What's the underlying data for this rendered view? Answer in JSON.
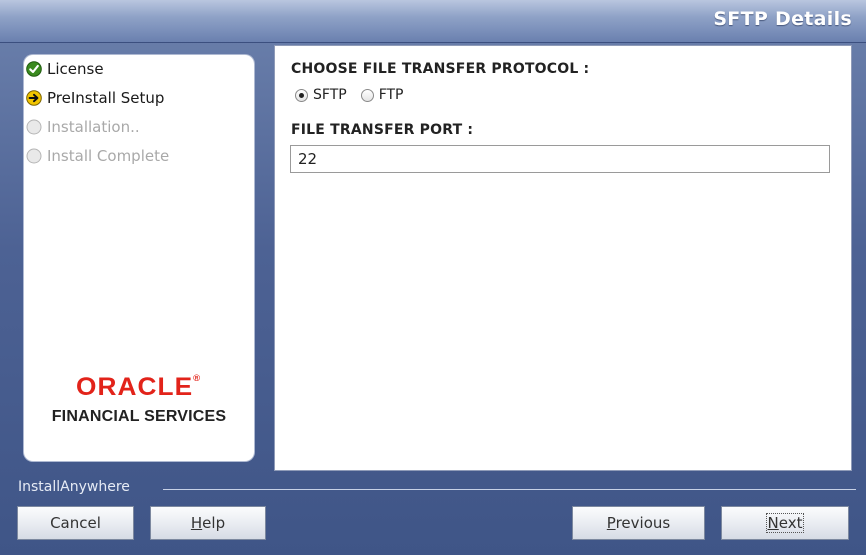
{
  "header": {
    "title": "SFTP Details"
  },
  "steps": [
    {
      "label": "License",
      "status": "complete",
      "icon": "check-icon"
    },
    {
      "label": "PreInstall Setup",
      "status": "current",
      "icon": "arrow-right-icon"
    },
    {
      "label": "Installation..",
      "status": "pending",
      "icon": "empty-circle-icon"
    },
    {
      "label": "Install Complete",
      "status": "pending",
      "icon": "empty-circle-icon"
    }
  ],
  "logo": {
    "brand": "ORACLE",
    "trademark": "®",
    "subtitle": "FINANCIAL SERVICES"
  },
  "form": {
    "protocol_label": "CHOOSE FILE TRANSFER PROTOCOL :",
    "protocol_options": [
      {
        "label": "SFTP",
        "selected": true
      },
      {
        "label": "FTP",
        "selected": false
      }
    ],
    "port_label": "FILE TRANSFER PORT :",
    "port_value": "22"
  },
  "footer": {
    "vendor": "InstallAnywhere",
    "cancel_label": "Cancel",
    "help_label": "Help",
    "previous_label": "Previous",
    "next_label": "Next"
  },
  "colors": {
    "brand_red": "#e2231a",
    "check_green": "#3a8a1e",
    "arrow_yellow": "#f2c500",
    "header_blue": "#6a80af"
  }
}
